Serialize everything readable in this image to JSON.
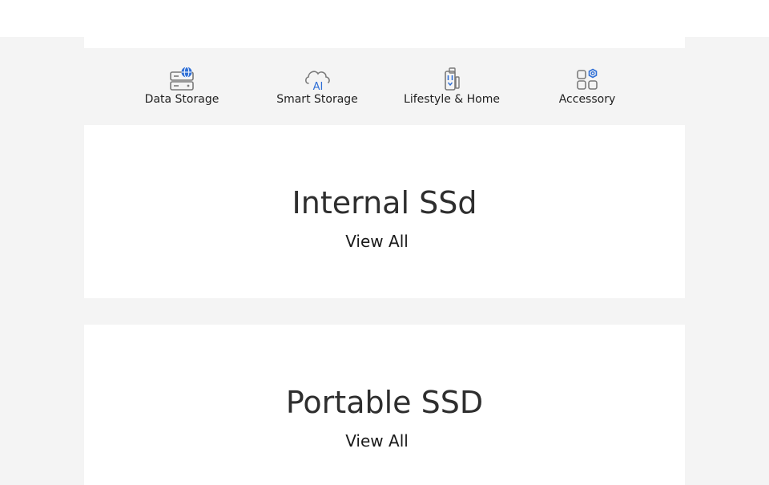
{
  "categories": [
    {
      "label": "Data Storage",
      "icon": "server-globe-icon"
    },
    {
      "label": "Smart Storage",
      "icon": "cloud-ai-icon"
    },
    {
      "label": "Lifestyle & Home",
      "icon": "phone-drive-icon"
    },
    {
      "label": "Accessory",
      "icon": "grid-gear-icon"
    }
  ],
  "sections": [
    {
      "title": "Internal SSd",
      "link": "View All"
    },
    {
      "title": "Portable SSD",
      "link": "View All"
    }
  ],
  "colors": {
    "accent": "#2f6fd6",
    "icon_stroke": "#7a7a7a",
    "page_bg": "#f4f4f4",
    "card_bg": "#ffffff"
  }
}
